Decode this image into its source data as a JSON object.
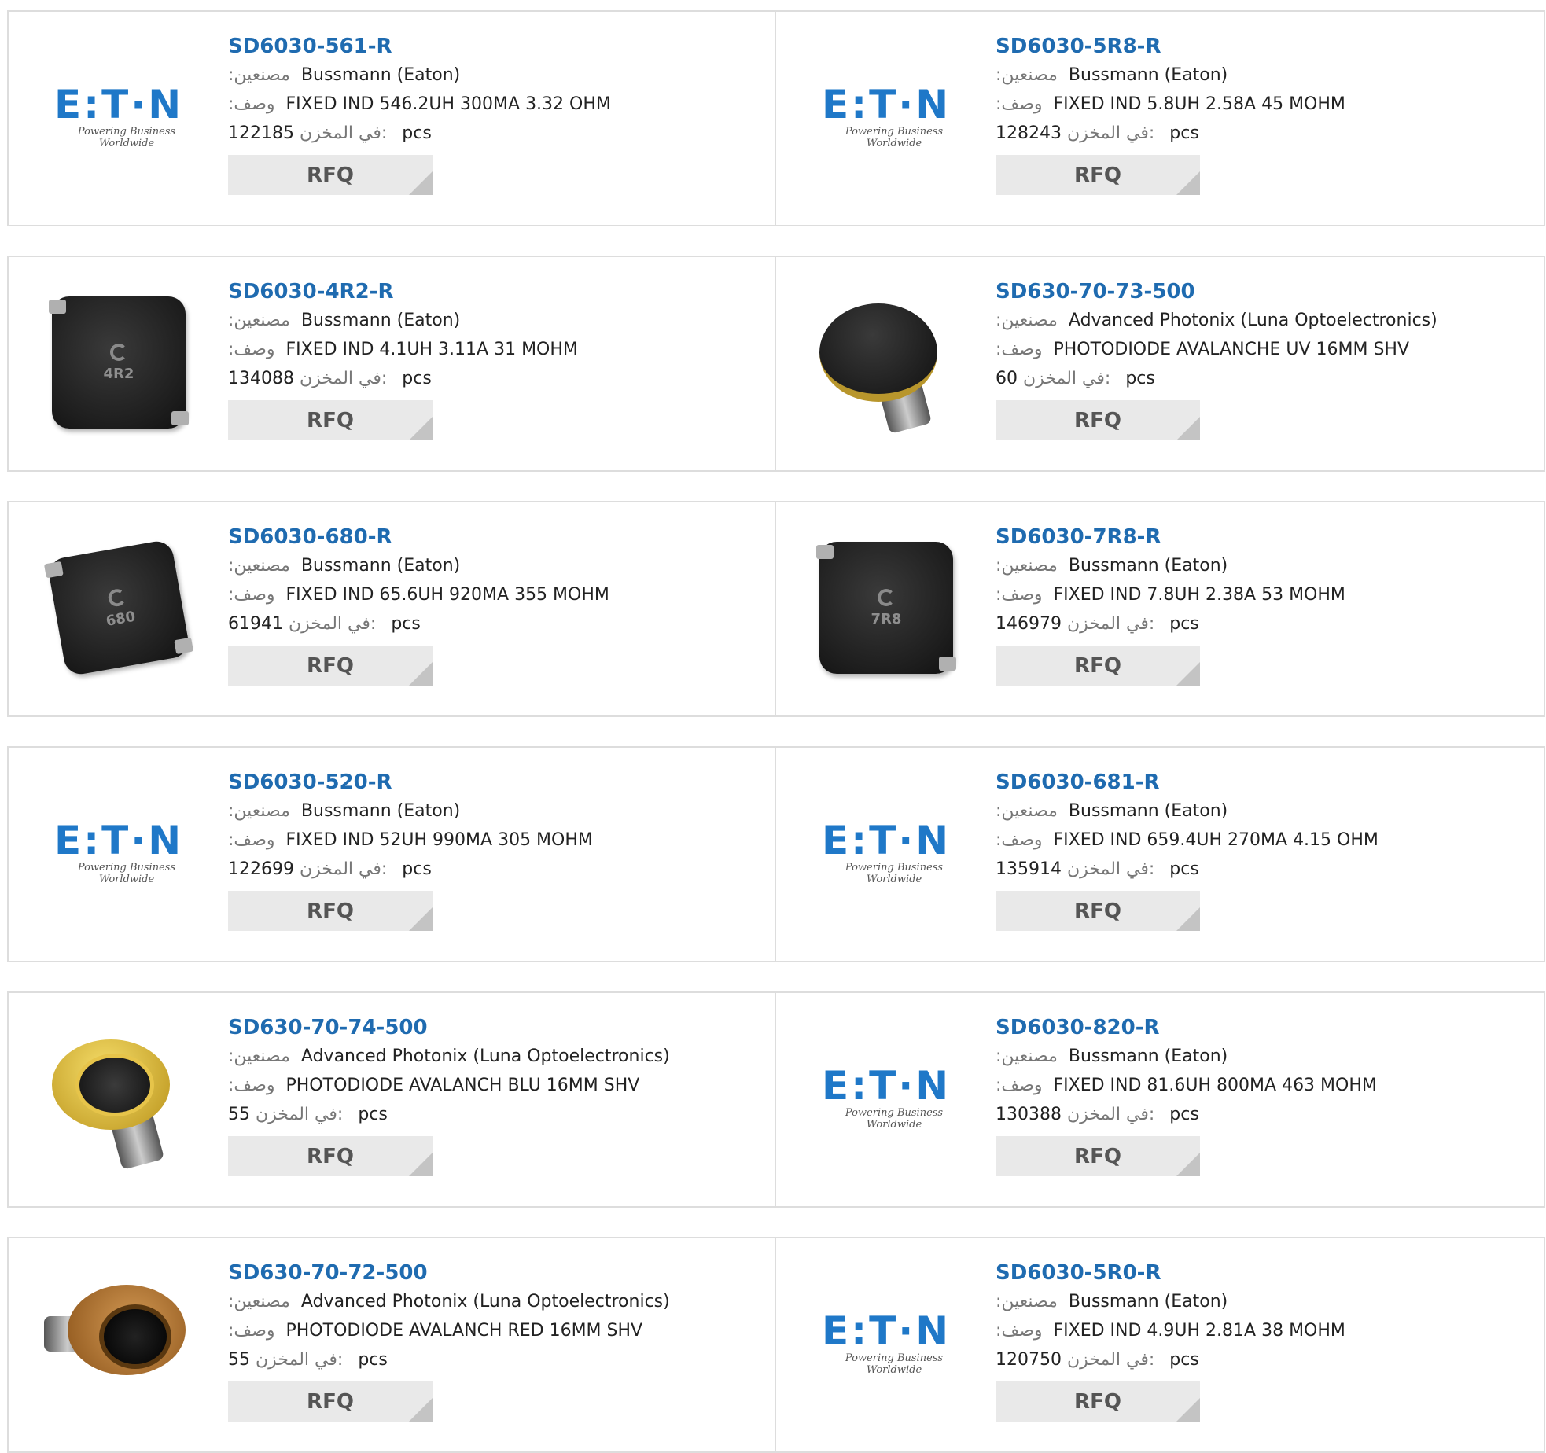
{
  "labels": {
    "manufacturer": ":مصنعين",
    "description": ":وصف",
    "stock": "في المخزن:",
    "unit": "pcs",
    "rfq": "RFQ"
  },
  "eaton_logo": {
    "word": "E:T·N",
    "tagline": "Powering Business Worldwide"
  },
  "products": [
    {
      "part": "SD6030-561-R",
      "manufacturer": "Bussmann (Eaton)",
      "description": "FIXED IND 546.2UH 300MA 3.32 OHM",
      "stock": "122185",
      "image": "eaton-logo"
    },
    {
      "part": "SD6030-5R8-R",
      "manufacturer": "Bussmann (Eaton)",
      "description": "FIXED IND 5.8UH 2.58A 45 MOHM",
      "stock": "128243",
      "image": "eaton-logo"
    },
    {
      "part": "SD6030-4R2-R",
      "manufacturer": "Bussmann (Eaton)",
      "description": "FIXED IND 4.1UH 3.11A 31 MOHM",
      "stock": "134088",
      "image": "inductor",
      "image_code": "4R2"
    },
    {
      "part": "SD630-70-73-500",
      "manufacturer": "Advanced Photonix (Luna Optoelectronics)",
      "description": "PHOTODIODE AVALANCHE UV 16MM SHV",
      "stock": "60",
      "image": "photodiode-black"
    },
    {
      "part": "SD6030-680-R",
      "manufacturer": "Bussmann (Eaton)",
      "description": "FIXED IND 65.6UH 920MA 355 MOHM",
      "stock": "61941",
      "image": "inductor-tilted",
      "image_code": "680"
    },
    {
      "part": "SD6030-7R8-R",
      "manufacturer": "Bussmann (Eaton)",
      "description": "FIXED IND 7.8UH 2.38A 53 MOHM",
      "stock": "146979",
      "image": "inductor",
      "image_code": "7R8"
    },
    {
      "part": "SD6030-520-R",
      "manufacturer": "Bussmann (Eaton)",
      "description": "FIXED IND 52UH 990MA 305 MOHM",
      "stock": "122699",
      "image": "eaton-logo"
    },
    {
      "part": "SD6030-681-R",
      "manufacturer": "Bussmann (Eaton)",
      "description": "FIXED IND 659.4UH 270MA 4.15 OHM",
      "stock": "135914",
      "image": "eaton-logo"
    },
    {
      "part": "SD630-70-74-500",
      "manufacturer": "Advanced Photonix (Luna Optoelectronics)",
      "description": "PHOTODIODE AVALANCH BLU 16MM SHV",
      "stock": "55",
      "image": "photodiode-gold"
    },
    {
      "part": "SD6030-820-R",
      "manufacturer": "Bussmann (Eaton)",
      "description": "FIXED IND 81.6UH 800MA 463 MOHM",
      "stock": "130388",
      "image": "eaton-logo"
    },
    {
      "part": "SD630-70-72-500",
      "manufacturer": "Advanced Photonix (Luna Optoelectronics)",
      "description": "PHOTODIODE AVALANCH RED 16MM SHV",
      "stock": "55",
      "image": "photodiode-copper"
    },
    {
      "part": "SD6030-5R0-R",
      "manufacturer": "Bussmann (Eaton)",
      "description": "FIXED IND 4.9UH 2.81A 38 MOHM",
      "stock": "120750",
      "image": "eaton-logo"
    }
  ]
}
